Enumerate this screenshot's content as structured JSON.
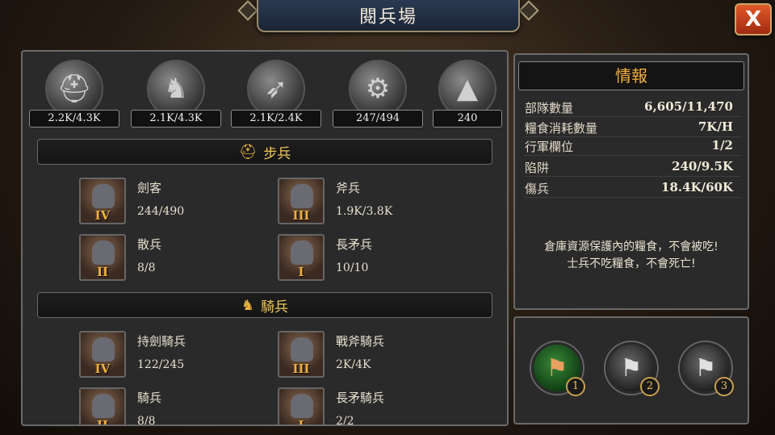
{
  "window": {
    "title": "閱兵場",
    "close_label": "X"
  },
  "resources": [
    {
      "icon": "helmet-icon",
      "value": "2.2K/4.3K"
    },
    {
      "icon": "horse-armor-icon",
      "value": "2.1K/4.3K"
    },
    {
      "icon": "bow-icon",
      "value": "2.1K/2.4K"
    },
    {
      "icon": "siege-cart-icon",
      "value": "247/494"
    },
    {
      "icon": "spike-trap-icon",
      "value": "240"
    }
  ],
  "infantry": {
    "title": "步兵",
    "units": [
      {
        "name": "劍客",
        "count": "244/490",
        "rank": "IV"
      },
      {
        "name": "斧兵",
        "count": "1.9K/3.8K",
        "rank": "III"
      },
      {
        "name": "散兵",
        "count": "8/8",
        "rank": "II"
      },
      {
        "name": "長矛兵",
        "count": "10/10",
        "rank": "I"
      }
    ]
  },
  "cavalry": {
    "title": "騎兵",
    "units": [
      {
        "name": "持劍騎兵",
        "count": "122/245",
        "rank": "IV"
      },
      {
        "name": "戰斧騎兵",
        "count": "2K/4K",
        "rank": "III"
      },
      {
        "name": "騎兵",
        "count": "8/8",
        "rank": "II"
      },
      {
        "name": "長矛騎兵",
        "count": "2/2",
        "rank": "I"
      }
    ]
  },
  "info": {
    "title": "情報",
    "rows": [
      {
        "label": "部隊數量",
        "value": "6,605/11,470"
      },
      {
        "label": "糧食消耗數量",
        "value": "7K/H"
      },
      {
        "label": "行軍欄位",
        "value": "1/2"
      },
      {
        "label": "陷阱",
        "value": "240/9.5K"
      },
      {
        "label": "傷兵",
        "value": "18.4K/60K"
      }
    ],
    "note_line1": "倉庫資源保護內的糧食，不會被吃!",
    "note_line2": "士兵不吃糧食，不會死亡!"
  },
  "flags": [
    {
      "num": "1",
      "state": "active"
    },
    {
      "num": "2",
      "state": "idle"
    },
    {
      "num": "3",
      "state": "idle"
    }
  ],
  "colors": {
    "accent_gold": "#f2b040",
    "close_red": "#e05a2a",
    "active_green": "#3a8a3a"
  }
}
